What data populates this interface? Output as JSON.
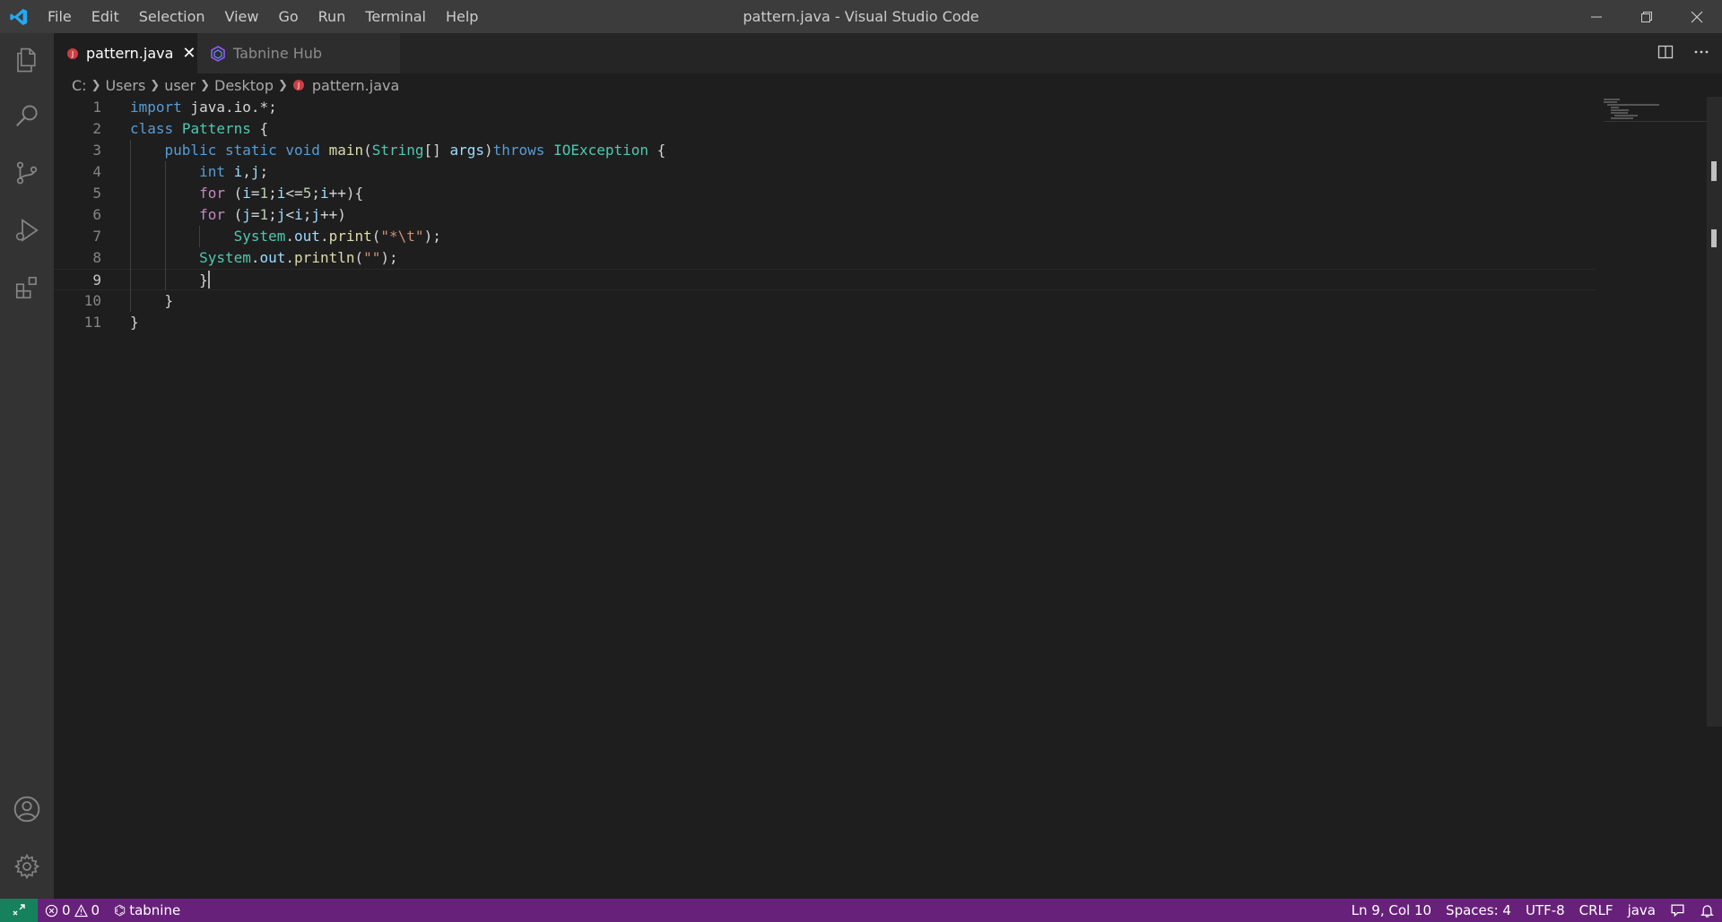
{
  "window": {
    "title": "pattern.java - Visual Studio Code"
  },
  "menu": [
    "File",
    "Edit",
    "Selection",
    "View",
    "Go",
    "Run",
    "Terminal",
    "Help"
  ],
  "activitybar": {
    "icons": [
      "explorer-icon",
      "search-icon",
      "source-control-icon",
      "run-debug-icon",
      "extensions-icon",
      "account-icon",
      "settings-gear-icon"
    ]
  },
  "tabs": [
    {
      "label": "pattern.java",
      "active": true,
      "icon": "java-file-icon"
    },
    {
      "label": "Tabnine Hub",
      "active": false,
      "icon": "tabnine-icon"
    }
  ],
  "breadcrumb": [
    "C:",
    "Users",
    "user",
    "Desktop",
    "pattern.java"
  ],
  "editor": {
    "lines": [
      {
        "num": "1",
        "text": "import java.io.*;"
      },
      {
        "num": "2",
        "text": "class Patterns {"
      },
      {
        "num": "3",
        "text": "    public static void main(String[] args)throws IOException {"
      },
      {
        "num": "4",
        "text": "        int i,j;"
      },
      {
        "num": "5",
        "text": "        for (i=1;i<=5;i++){"
      },
      {
        "num": "6",
        "text": "        for (j=1;j<i;j++)"
      },
      {
        "num": "7",
        "text": "            System.out.print(\"*\\t\");"
      },
      {
        "num": "8",
        "text": "        System.out.println(\"\");"
      },
      {
        "num": "9",
        "text": "        }"
      },
      {
        "num": "10",
        "text": "    }"
      },
      {
        "num": "11",
        "text": "}"
      }
    ],
    "active_line": 9
  },
  "statusbar": {
    "errors": "0",
    "warnings": "0",
    "tabnine": "tabnine",
    "position": "Ln 9, Col 10",
    "spaces": "Spaces: 4",
    "encoding": "UTF-8",
    "eol": "CRLF",
    "language": "java"
  },
  "colors": {
    "statusbar": "#68217a",
    "remote": "#16825d",
    "activitybar": "#333333",
    "editor": "#1e1e1e",
    "titlebar": "#3c3c3c"
  }
}
